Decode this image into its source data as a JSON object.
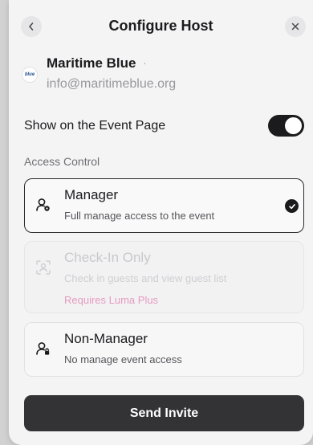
{
  "dialog": {
    "title": "Configure Host",
    "back_icon": "chevron-left-icon",
    "close_icon": "close-icon"
  },
  "host": {
    "logo_text": "blue",
    "name": "Maritime Blue",
    "separator": "·",
    "email": "info@maritimeblue.org"
  },
  "show_on_event": {
    "label": "Show on the Event Page",
    "enabled": true
  },
  "access": {
    "section_label": "Access Control",
    "options": [
      {
        "title": "Manager",
        "description": "Full manage access to the event",
        "selected": true,
        "icon": "user-gear-icon"
      },
      {
        "title": "Check-In Only",
        "description": "Check in guests and view guest list",
        "note": "Requires Luma Plus",
        "disabled": true,
        "icon": "scan-user-icon"
      },
      {
        "title": "Non-Manager",
        "description": "No manage event access",
        "selected": false,
        "icon": "user-lock-icon"
      }
    ]
  },
  "send_button": {
    "label": "Send Invite"
  },
  "colors": {
    "accent": "#1b1b1d",
    "note_pink": "#e59bc0",
    "button_bg": "#333336"
  }
}
